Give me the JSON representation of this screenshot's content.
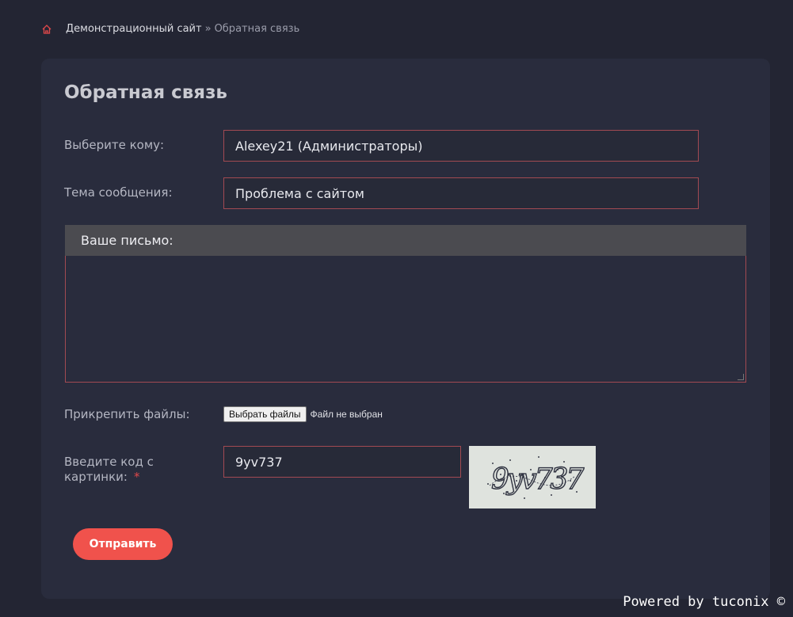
{
  "breadcrumb": {
    "home_icon": "home-icon",
    "site": "Демонстрационный сайт",
    "separator": "»",
    "current": "Обратная связь"
  },
  "form": {
    "title": "Обратная связь",
    "recipient_label": "Выберите кому:",
    "recipient_value": "Alexey21 (Администраторы)",
    "subject_label": "Тема сообщения:",
    "subject_value": "Проблема с сайтом",
    "letter_label": "Ваше письмо:",
    "letter_value": "",
    "attach_label": "Прикрепить файлы:",
    "file_button": "Выбрать файлы",
    "file_status": "Файл не выбран",
    "captcha_label": "Введите код с картинки:",
    "captcha_required": "*",
    "captcha_value": "9yv737",
    "captcha_image_text": "9yv737",
    "submit_label": "Отправить"
  },
  "footer": {
    "powered": "Powered by tuconix ©"
  },
  "colors": {
    "accent": "#f0524c",
    "border": "#a24a52",
    "background": "#232533",
    "card": "#292c3d"
  }
}
